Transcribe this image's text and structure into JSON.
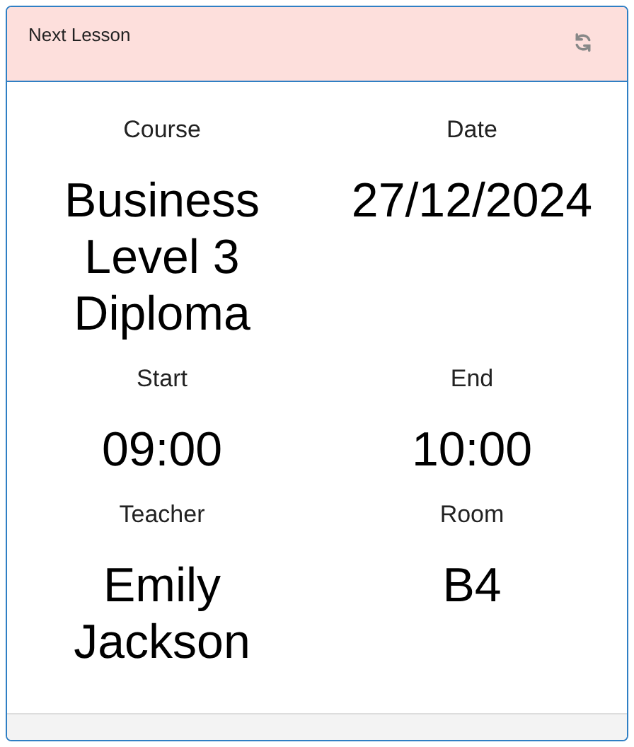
{
  "card": {
    "title": "Next Lesson",
    "fields": [
      {
        "label": "Course",
        "value": "Business Level 3 Diploma"
      },
      {
        "label": "Date",
        "value": "27/12/2024"
      },
      {
        "label": "Start",
        "value": "09:00"
      },
      {
        "label": "End",
        "value": "10:00"
      },
      {
        "label": "Teacher",
        "value": "Emily Jackson"
      },
      {
        "label": "Room",
        "value": "B4"
      }
    ]
  }
}
